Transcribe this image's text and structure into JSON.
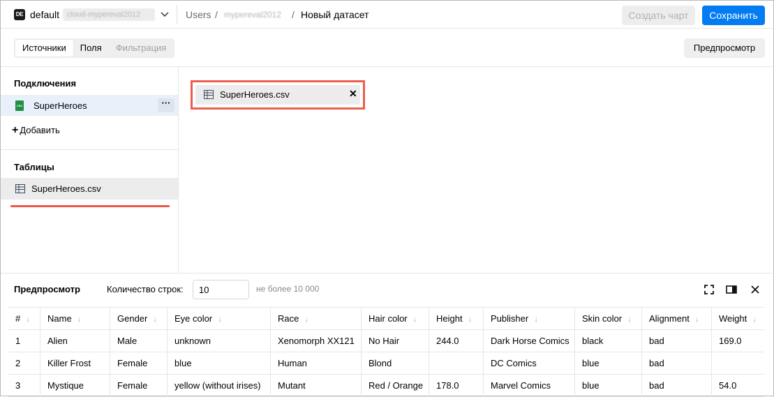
{
  "header": {
    "workspace_logo": "DE",
    "workspace_name": "default",
    "workspace_id_blurred": "cloud-mypereval2012",
    "breadcrumb": [
      {
        "label": "Users"
      },
      {
        "label": "mypereval2012"
      },
      {
        "label": "Новый датасет"
      }
    ],
    "breadcrumb_separator": "/",
    "create_chart_label": "Создать чарт",
    "save_label": "Сохранить",
    "primary_color": "#027bf3"
  },
  "toolbar": {
    "tabs": [
      {
        "label": "Источники",
        "state": "active"
      },
      {
        "label": "Поля",
        "state": "normal"
      },
      {
        "label": "Фильтрация",
        "state": "disabled"
      }
    ],
    "preview_label": "Предпросмотр"
  },
  "sidebar": {
    "connections_title": "Подключения",
    "connection": {
      "icon": "csv-file-icon",
      "icon_text": "CSV",
      "label": "SuperHeroes",
      "menu": "···"
    },
    "add_label": "Добавить",
    "tables_title": "Таблицы",
    "table": {
      "icon": "table-icon",
      "label": "SuperHeroes.csv"
    }
  },
  "canvas": {
    "source": {
      "icon": "table-icon",
      "label": "SuperHeroes.csv",
      "close": "✕"
    },
    "highlight_color": "#ef5d4c"
  },
  "preview": {
    "title": "Предпросмотр",
    "rows_label": "Количество строк:",
    "rows_value": "10",
    "rows_hint": "не более 10 000",
    "columns": [
      "#",
      "Name",
      "Gender",
      "Eye color",
      "Race",
      "Hair color",
      "Height",
      "Publisher",
      "Skin color",
      "Alignment",
      "Weight"
    ],
    "rows": [
      [
        "1",
        "Alien",
        "Male",
        "unknown",
        "Xenomorph XX121",
        "No Hair",
        "244.0",
        "Dark Horse Comics",
        "black",
        "bad",
        "169.0"
      ],
      [
        "2",
        "Killer Frost",
        "Female",
        "blue",
        "Human",
        "Blond",
        "",
        "DC Comics",
        "blue",
        "bad",
        ""
      ],
      [
        "3",
        "Mystique",
        "Female",
        "yellow (without irises)",
        "Mutant",
        "Red / Orange",
        "178.0",
        "Marvel Comics",
        "blue",
        "bad",
        "54.0"
      ]
    ]
  }
}
